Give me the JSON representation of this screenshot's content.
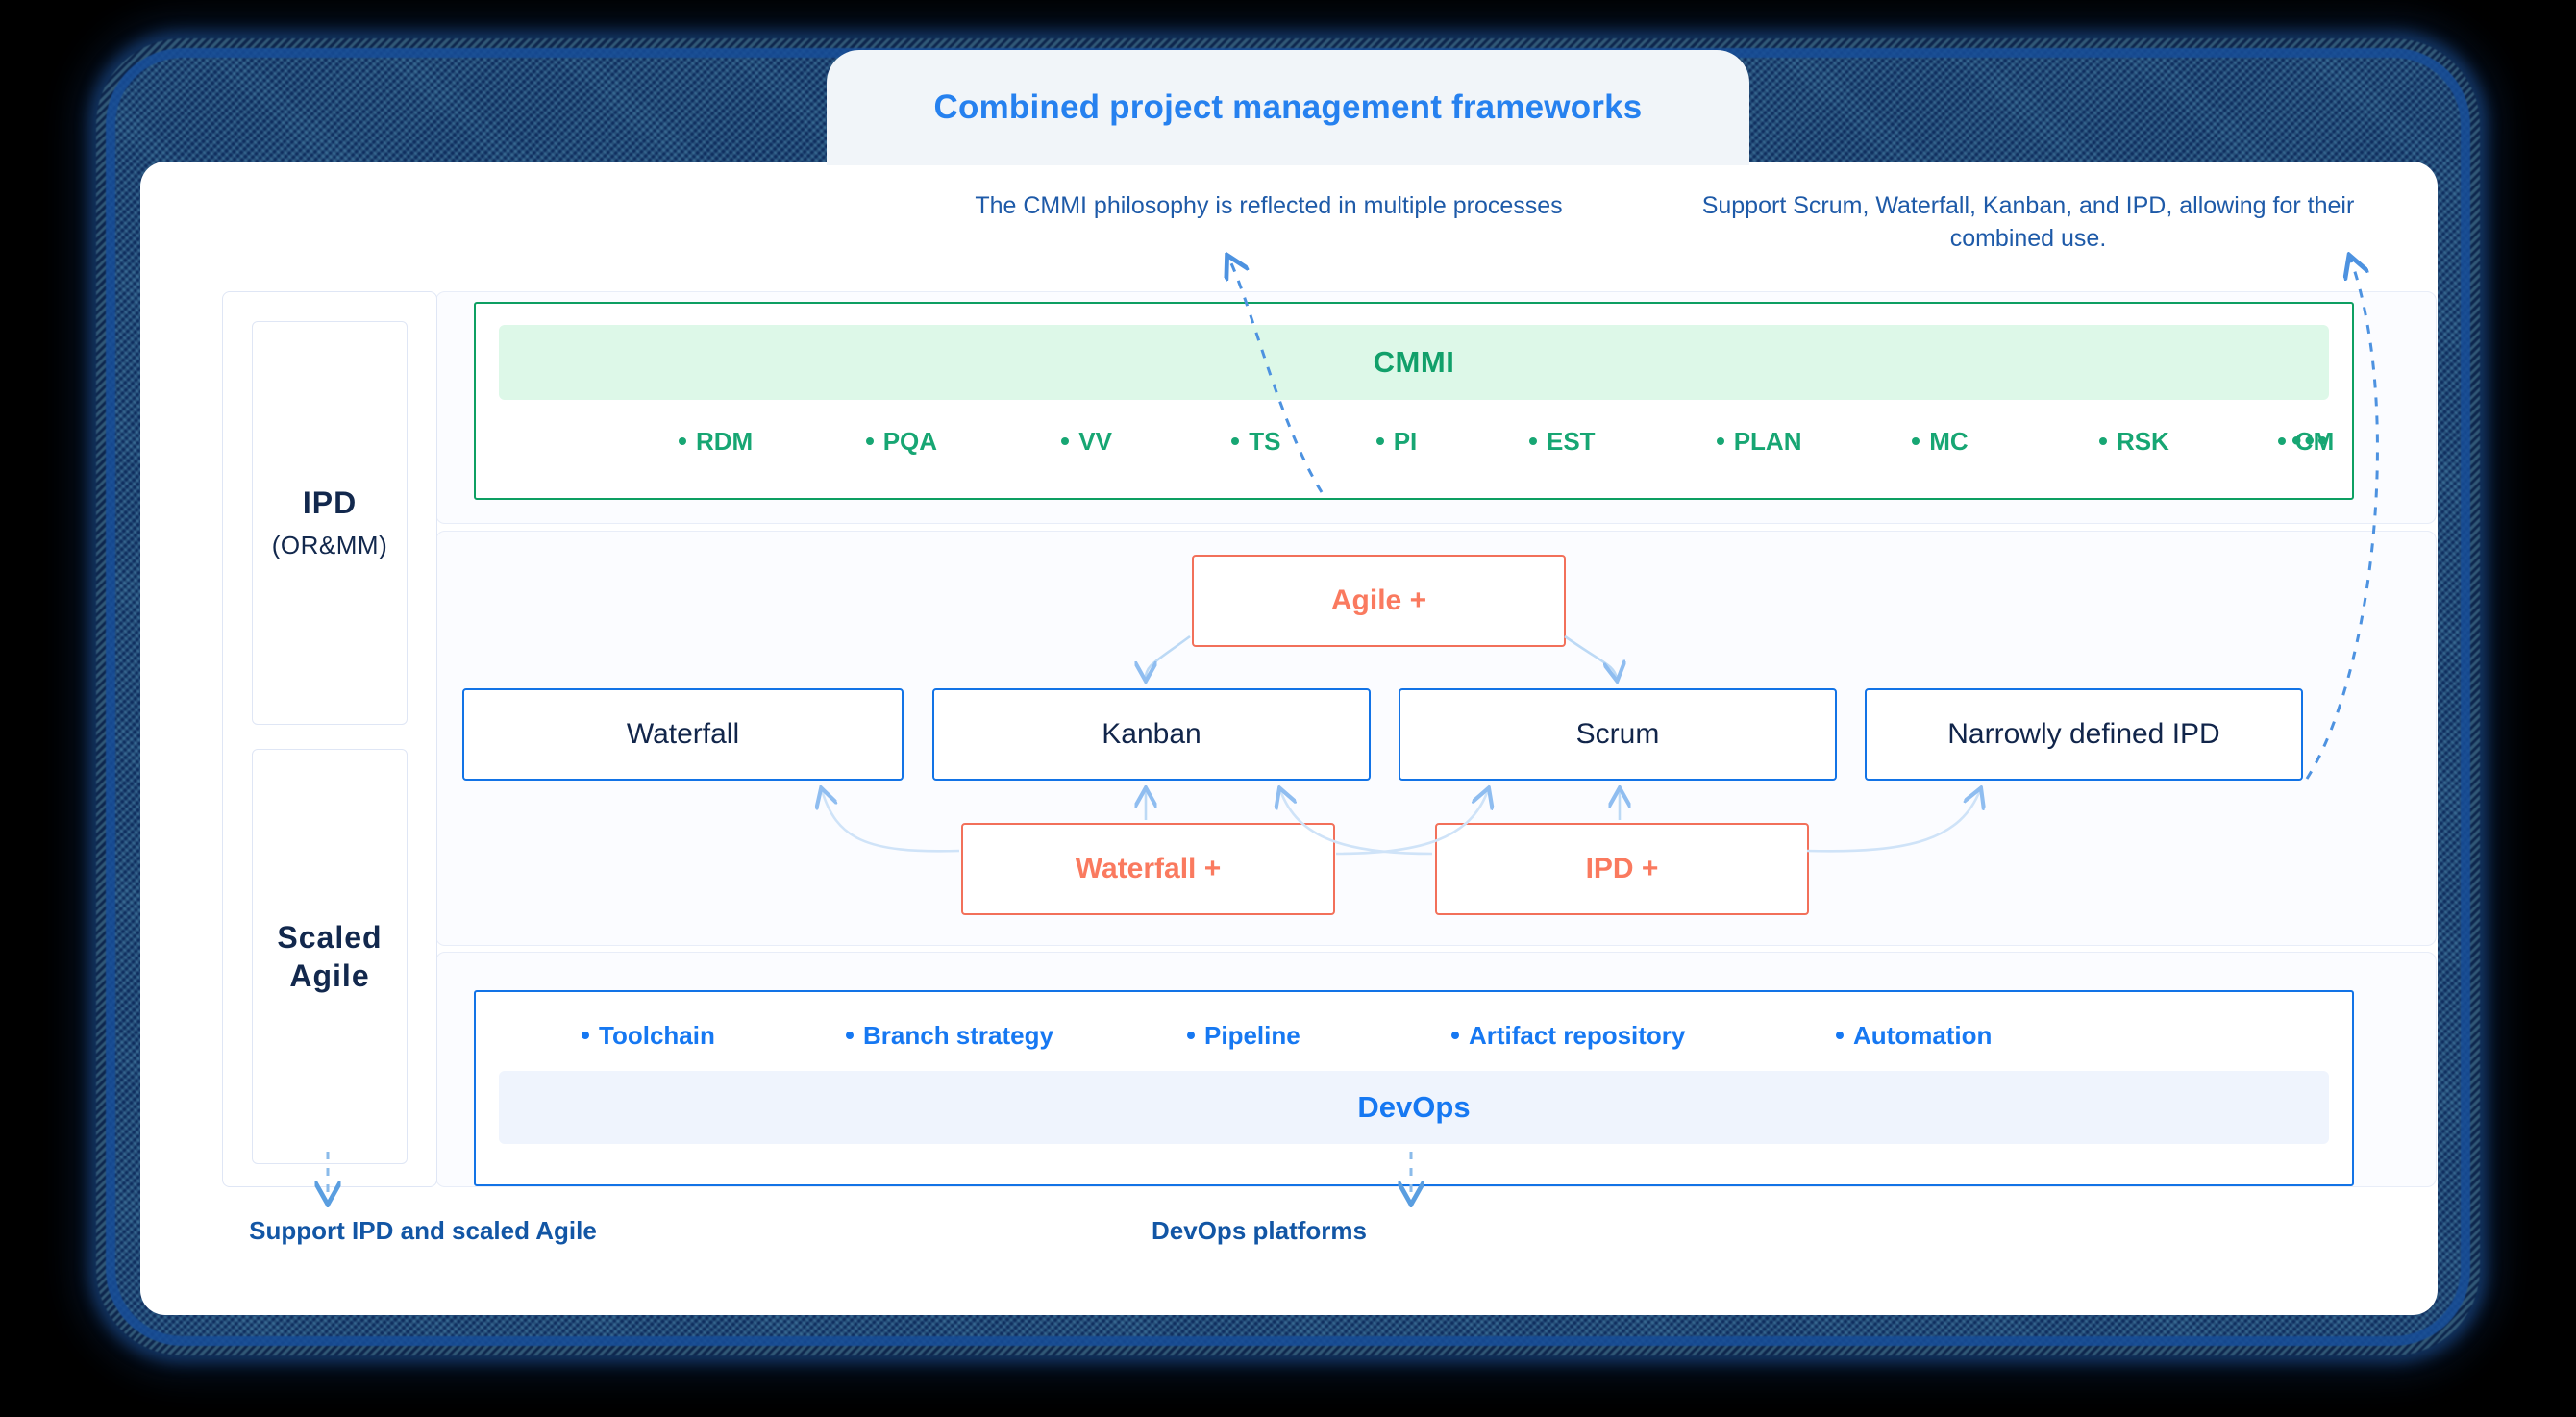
{
  "header": {
    "title": "Combined project management frameworks",
    "accent_color": "#2681ef",
    "tab_bg": "#f1f5f9"
  },
  "annotations": {
    "cmmi_note": "The CMMI philosophy is reflected in multiple processes",
    "support_note": "Support Scrum, Waterfall, Kanban, and IPD, allowing for their combined use.",
    "bottom_left": "Support IPD and scaled Agile",
    "bottom_right": "DevOps platforms"
  },
  "sidebar": {
    "boxes": [
      {
        "title": "IPD",
        "subtitle": "(OR&MM)"
      },
      {
        "title": "Scaled Agile",
        "subtitle": ""
      }
    ]
  },
  "cmmi": {
    "label": "CMMI",
    "border_color": "#0d9f62",
    "band_color": "#ddf8e8",
    "text_color": "#17a673",
    "items": [
      "RDM",
      "PQA",
      "VV",
      "TS",
      "PI",
      "EST",
      "PLAN",
      "MC",
      "RSK",
      "CM"
    ],
    "ellipsis": "•••"
  },
  "frameworks": {
    "base_boxes": [
      {
        "label": "Waterfall"
      },
      {
        "label": "Kanban"
      },
      {
        "label": "Scrum"
      },
      {
        "label": "Narrowly defined IPD"
      }
    ],
    "plus_boxes": [
      {
        "label": "Agile +"
      },
      {
        "label": "Waterfall +"
      },
      {
        "label": "IPD +"
      }
    ],
    "base_color": "#1273e6",
    "plus_color": "#fa7a5f"
  },
  "devops": {
    "label": "DevOps",
    "border_color": "#1273e6",
    "band_color": "#eff4fd",
    "text_color": "#1678f2",
    "items": [
      "Toolchain",
      "Branch strategy",
      "Pipeline",
      "Artifact repository",
      "Automation"
    ]
  }
}
